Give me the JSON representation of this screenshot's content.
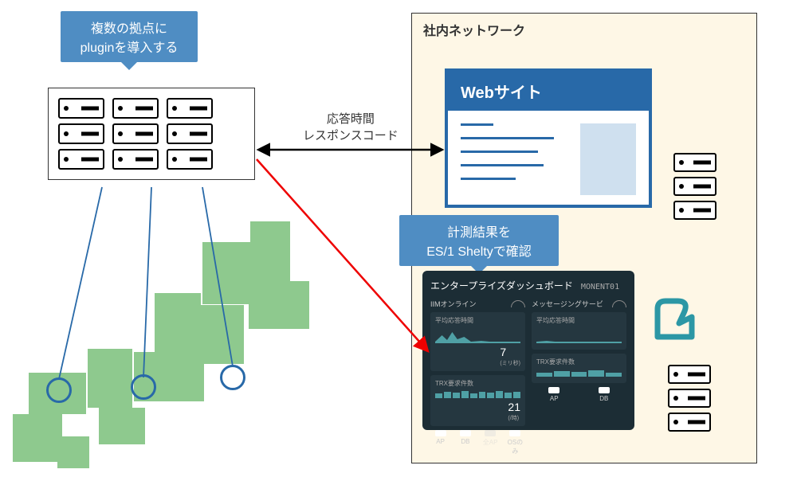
{
  "callouts": {
    "plugin": {
      "line1": "複数の拠点に",
      "line2": "pluginを導入する"
    },
    "shelty": {
      "line1": "計測結果を",
      "line2": "ES/1 Sheltyで確認"
    }
  },
  "network": {
    "label": "社内ネットワーク"
  },
  "website": {
    "title": "Webサイト"
  },
  "arrow": {
    "line1": "応答時間",
    "line2": "レスポンスコード"
  },
  "dashboard": {
    "title": "エンタープライズダッシュボード",
    "code": "MONENT01",
    "left": {
      "section": "IIMオンライン",
      "metric1_label": "平均応答時間",
      "metric1_value": "7",
      "metric1_unit": "(ミリ秒)",
      "metric2_label": "TRX要求件数",
      "metric2_value": "21",
      "metric2_unit": "(/時)"
    },
    "right": {
      "section": "メッセージングサービ",
      "metric1_label": "平均応答時間",
      "metric2_label": "TRX要求件数"
    },
    "footer": [
      "AP",
      "DB",
      "全AP",
      "OSのみ",
      "AP",
      "DB"
    ]
  }
}
